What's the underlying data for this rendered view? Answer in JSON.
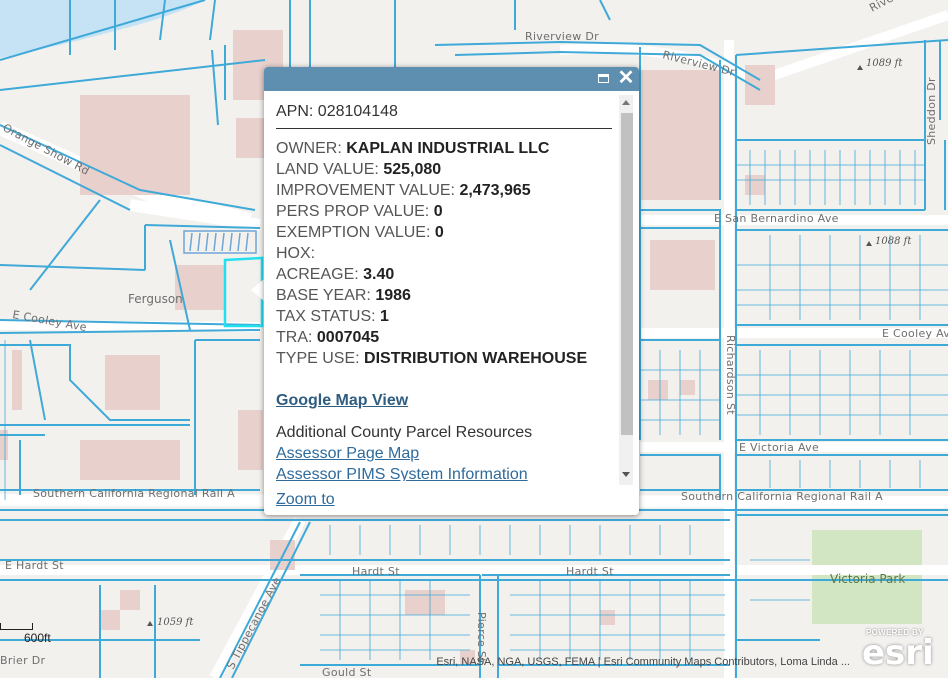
{
  "map": {
    "roads": {
      "riverview_dr": "Riverview Dr",
      "riverview_dr_2": "Riverview Dr",
      "riverview_dr_3": "Riverview",
      "orange_show_rd": "Orange Show Rd",
      "e_san_bernardino_ave": "E San Bernardino Ave",
      "e_cooley_ave_left": "E Cooley Ave",
      "e_cooley_ave_right": "E Cooley Av",
      "richardson_st": "Richardson St",
      "e_victoria_ave": "E Victoria Ave",
      "rail_left": "Southern California Regional Rail A",
      "rail_right": "Southern California Regional Rail A",
      "e_hardt_st": "E Hardt St",
      "hardt_st_1": "Hardt St",
      "hardt_st_2": "Hardt St",
      "s_tippecanoe_ave": "S Tippecanoe Ave",
      "sheddon_dr": "Sheddon Dr",
      "brier_dr": "Brier Dr",
      "gould_st": "Gould St",
      "pierce_st": "Pierce St"
    },
    "places": {
      "ferguson": "Ferguson",
      "victoria_park": "Victoria Park"
    },
    "elevations": {
      "e1": "1089 ft",
      "e2": "1088 ft",
      "e3": "1059 ft"
    },
    "colors": {
      "parcel_line": "#3fa9d8",
      "selected_parcel": "#22e0f0",
      "building": "#e8d0cc",
      "water": "#c6e3f5",
      "park": "#d3e6c3",
      "road": "#ffffff",
      "land": "#f3f1ee"
    }
  },
  "popup": {
    "title_label": "APN:",
    "title_value": "028104148",
    "attributes": [
      {
        "label": "OWNER:",
        "value": "KAPLAN INDUSTRIAL LLC"
      },
      {
        "label": "LAND VALUE:",
        "value": "525,080"
      },
      {
        "label": "IMPROVEMENT VALUE:",
        "value": "2,473,965"
      },
      {
        "label": "PERS PROP VALUE:",
        "value": "0"
      },
      {
        "label": "EXEMPTION VALUE:",
        "value": "0"
      },
      {
        "label": "HOX:",
        "value": ""
      },
      {
        "label": "ACREAGE:",
        "value": "3.40"
      },
      {
        "label": "BASE YEAR:",
        "value": "1986"
      },
      {
        "label": "TAX STATUS:",
        "value": "1"
      },
      {
        "label": "TRA:",
        "value": "0007045"
      },
      {
        "label": "TYPE USE:",
        "value": "DISTRIBUTION WAREHOUSE"
      }
    ],
    "google_map_link": "Google Map View",
    "resources_title": "Additional County Parcel Resources",
    "resource_links": [
      "Assessor Page Map",
      "Assessor PIMS System Information"
    ],
    "zoom_link": "Zoom to",
    "maximize_icon": "maximize-icon",
    "close_icon": "close-icon",
    "close_glyph": "✕"
  },
  "scale": {
    "label": "600ft"
  },
  "attribution": "Esri, NASA, NGA, USGS, FEMA | Esri Community Maps Contributors, Loma Linda ...",
  "esri_logo": {
    "powered": "POWERED BY",
    "word": "esri"
  }
}
